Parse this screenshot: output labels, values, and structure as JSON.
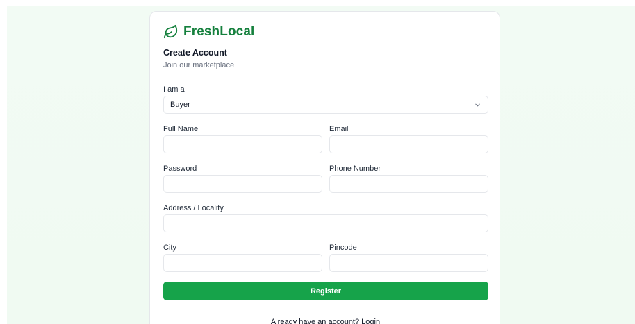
{
  "brand": {
    "name": "FreshLocal",
    "icon": "leaf-icon",
    "color": "#15803d"
  },
  "header": {
    "title": "Create Account",
    "subtitle": "Join our marketplace"
  },
  "role": {
    "label": "I am a",
    "selected": "Buyer",
    "icon": "chevron-down-icon"
  },
  "fields": {
    "full_name": {
      "label": "Full Name",
      "value": "",
      "placeholder": ""
    },
    "email": {
      "label": "Email",
      "value": "",
      "placeholder": ""
    },
    "password": {
      "label": "Password",
      "value": "",
      "placeholder": ""
    },
    "phone": {
      "label": "Phone Number",
      "value": "",
      "placeholder": ""
    },
    "address": {
      "label": "Address / Locality",
      "value": "",
      "placeholder": ""
    },
    "city": {
      "label": "City",
      "value": "",
      "placeholder": ""
    },
    "pincode": {
      "label": "Pincode",
      "value": "",
      "placeholder": ""
    }
  },
  "register": {
    "label": "Register",
    "color": "#16a34a"
  },
  "footer": {
    "text": "Already have an account?",
    "link": "Login"
  }
}
